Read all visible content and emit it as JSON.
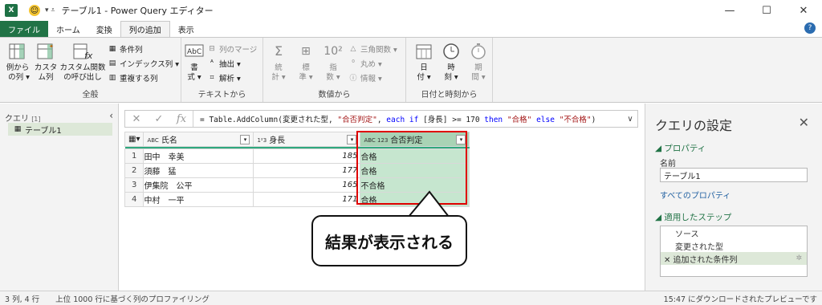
{
  "window": {
    "app_badge": "X",
    "title": "テーブル1 - Power Query エディター",
    "minimize": "—",
    "maximize": "☐",
    "close": "✕"
  },
  "tabs": [
    {
      "label": "ファイル"
    },
    {
      "label": "ホーム"
    },
    {
      "label": "変換"
    },
    {
      "label": "列の追加"
    },
    {
      "label": "表示"
    }
  ],
  "ribbon": {
    "general": {
      "label": "全般",
      "col_from_examples": "例から\n の列 ▾",
      "custom_col": "カスタ\nム列",
      "invoke_custom_fn": "カスタム関数\nの呼び出し",
      "conditional_col": "条件列",
      "index_col": "インデックス列 ▾",
      "duplicate_col": "重複する列"
    },
    "text": {
      "label": "テキストから",
      "format": "書\n式 ▾",
      "merge_cols": "列のマージ",
      "extract": "抽出 ▾",
      "parse": "解析 ▾"
    },
    "number": {
      "label": "数値から",
      "statistics": "統\n計 ▾",
      "standard": "標\n準 ▾",
      "scientific": "指\n数 ▾",
      "trig": "三角関数 ▾",
      "rounding": "丸め ▾",
      "info": "情報 ▾"
    },
    "datetime": {
      "label": "日付と時刻から",
      "date": "日\n付 ▾",
      "time": "時\n刻 ▾",
      "duration": "期\n間 ▾"
    }
  },
  "queries": {
    "title": "クエリ",
    "count": "[1]",
    "collapse": "‹",
    "items": [
      {
        "name": "テーブル1"
      }
    ]
  },
  "formula_bar": {
    "cancel": "✕",
    "confirm": "✓",
    "fx": "fx",
    "parts": {
      "p1": "= Table.AddColumn(変更された型, ",
      "p2": "\"合否判定\"",
      "p3": ", ",
      "p4": "each if",
      "p5": " [身長] >= 170 ",
      "p6": "then",
      "p7": " ",
      "p8": "\"合格\"",
      "p9": " ",
      "p10": "else",
      "p11": " ",
      "p12": "\"不合格\"",
      "p13": ")"
    },
    "expand": "∨"
  },
  "grid": {
    "columns": [
      {
        "type_icon": "ABC",
        "name": "氏名"
      },
      {
        "type_icon": "1²3",
        "name": "身長"
      },
      {
        "type_icon": "ABC 123",
        "name": "合否判定"
      }
    ],
    "rows": [
      {
        "n": "1",
        "name": "田中　幸美",
        "height": "185",
        "result": "合格"
      },
      {
        "n": "2",
        "name": "須藤　猛",
        "height": "177",
        "result": "合格"
      },
      {
        "n": "3",
        "name": "伊集院　公平",
        "height": "165",
        "result": "不合格"
      },
      {
        "n": "4",
        "name": "中村　一平",
        "height": "171",
        "result": "合格"
      }
    ]
  },
  "callout": {
    "text": "結果が表示される"
  },
  "settings": {
    "title": "クエリの設定",
    "close": "✕",
    "properties_header": "◢ プロパティ",
    "name_label": "名前",
    "name_value": "テーブル1",
    "all_properties": "すべてのプロパティ",
    "applied_steps_header": "◢ 適用したステップ",
    "steps": [
      {
        "label": "ソース"
      },
      {
        "label": "変更された型"
      },
      {
        "label": "✕ 追加された条件列"
      }
    ]
  },
  "status": {
    "left": "3 列, 4 行",
    "profiling": "上位 1000 行に基づく列のプロファイリング",
    "right": "15:47 にダウンロードされたプレビューです"
  },
  "colors": {
    "accent_green": "#217346",
    "selected_col": "#c6e6cf",
    "red_box": "#e00000"
  }
}
